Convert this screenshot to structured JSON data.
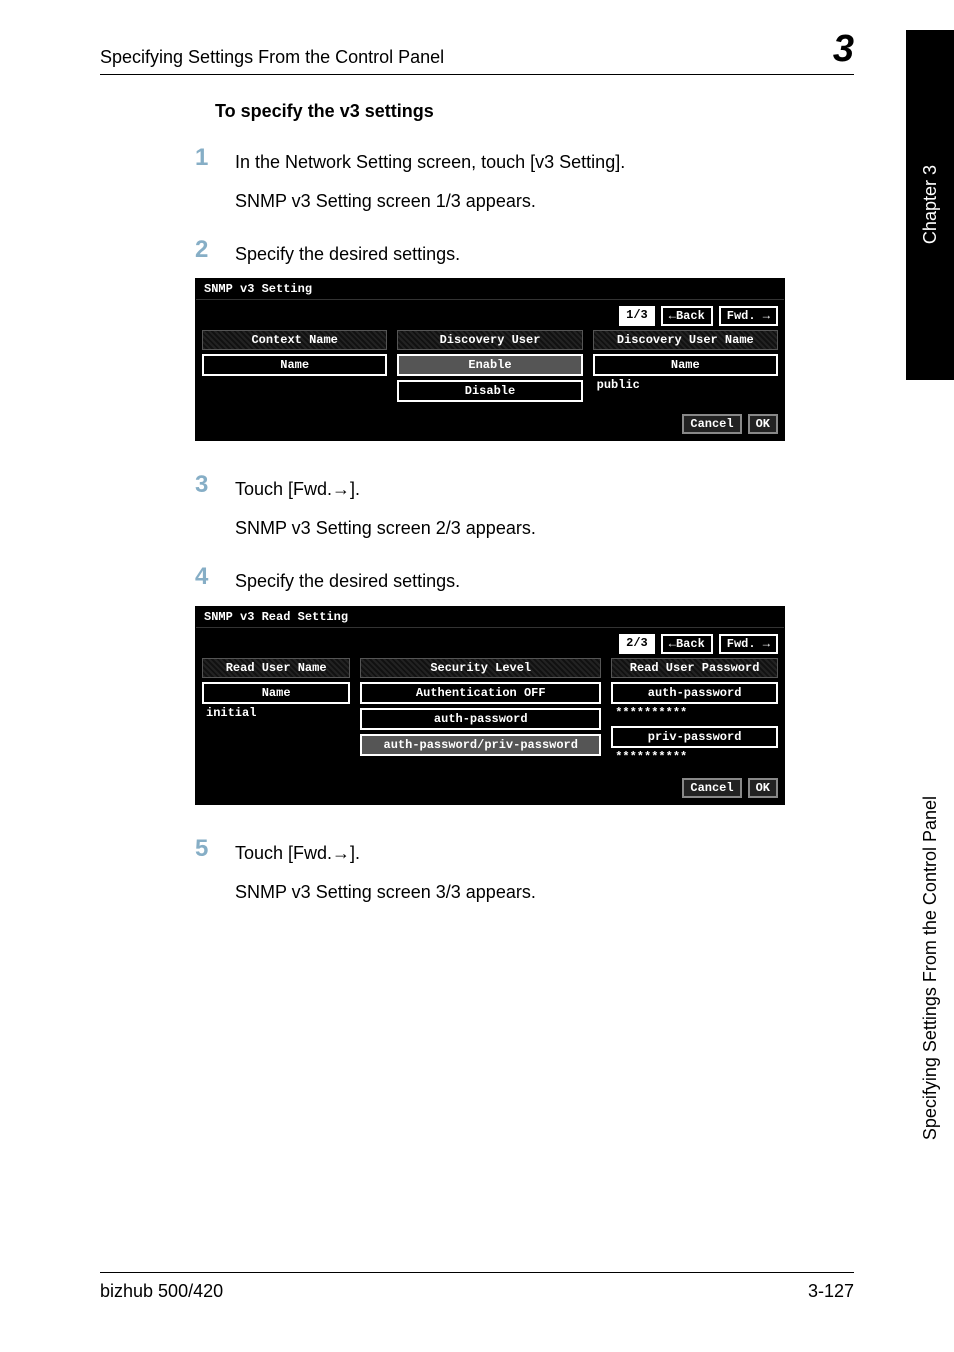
{
  "header": {
    "title": "Specifying Settings From the Control Panel",
    "chapterNumber": "3"
  },
  "sideTab": {
    "chapter": "Chapter 3",
    "title": "Specifying Settings From the Control Panel"
  },
  "sectionHeading": "To specify the v3 settings",
  "steps": {
    "s1": {
      "num": "1",
      "text": "In the Network Setting screen, touch [v3 Setting].",
      "sub": "SNMP v3 Setting screen 1/3 appears."
    },
    "s2": {
      "num": "2",
      "text": "Specify the desired settings."
    },
    "s3": {
      "num": "3",
      "text": "Touch [Fwd.→].",
      "sub": "SNMP v3 Setting screen 2/3 appears."
    },
    "s4": {
      "num": "4",
      "text": "Specify the desired settings."
    },
    "s5": {
      "num": "5",
      "text": "Touch [Fwd.→].",
      "sub": "SNMP v3 Setting screen 3/3 appears."
    }
  },
  "screenshot1": {
    "title": "SNMP v3 Setting",
    "counter": "1/3",
    "back": "←Back",
    "fwd": "Fwd. →",
    "col1Head": "Context Name",
    "col1Btn": "Name",
    "col2Head": "Discovery User",
    "col2Opt1": "Enable",
    "col2Opt2": "Disable",
    "col3Head": "Discovery User Name",
    "col3Btn": "Name",
    "col3Value": "public",
    "cancel": "Cancel",
    "ok": "OK"
  },
  "screenshot2": {
    "title": "SNMP v3 Read Setting",
    "counter": "2/3",
    "back": "←Back",
    "fwd": "Fwd. →",
    "col1Head": "Read User Name",
    "col1Btn": "Name",
    "col1Value": "initial",
    "col2Head": "Security Level",
    "col2Opt1": "Authentication OFF",
    "col2Opt2": "auth-password",
    "col2Opt3": "auth-password/priv-password",
    "col3Head": "Read User Password",
    "col3Btn1": "auth-password",
    "col3Val1": "**********",
    "col3Btn2": "priv-password",
    "col3Val2": "**********",
    "cancel": "Cancel",
    "ok": "OK"
  },
  "footer": {
    "model": "bizhub 500/420",
    "page": "3-127"
  }
}
